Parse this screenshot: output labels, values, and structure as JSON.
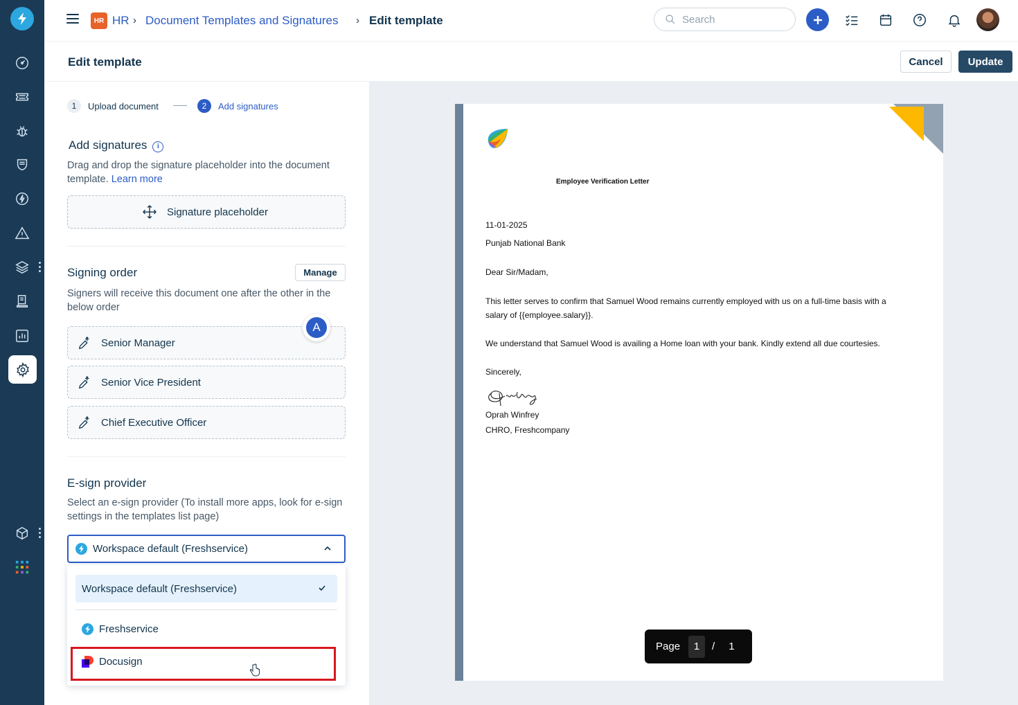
{
  "breadcrumb": {
    "module_badge": "HR",
    "module": "HR",
    "section": "Document Templates and Signatures",
    "current": "Edit template"
  },
  "search": {
    "placeholder": "Search"
  },
  "header": {
    "title": "Edit template",
    "cancel_label": "Cancel",
    "update_label": "Update"
  },
  "steps": [
    {
      "number": "1",
      "label": "Upload document"
    },
    {
      "number": "2",
      "label": "Add signatures"
    }
  ],
  "add_signatures": {
    "title": "Add signatures",
    "description": "Drag and drop the signature placeholder into the document template.",
    "learn_more": "Learn more",
    "placeholder_label": "Signature placeholder"
  },
  "signing_order": {
    "title": "Signing order",
    "manage_label": "Manage",
    "description": "Signers will receive this document one after the other in the below order",
    "signers": [
      "Senior Manager",
      "Senior Vice President",
      "Chief Executive Officer"
    ],
    "marker_letter": "A"
  },
  "esign": {
    "title": "E-sign provider",
    "description": "Select an e-sign provider (To install more apps, look for e-sign settings in the templates list page)",
    "selected": "Workspace default (Freshservice)",
    "options": [
      "Workspace default (Freshservice)",
      "Freshservice",
      "Docusign"
    ]
  },
  "document": {
    "title": "Employee Verification Letter",
    "date": "11-01-2025",
    "recipient": "Punjab National Bank",
    "salutation": "Dear Sir/Madam,",
    "para1_line1": "This letter serves to confirm that Samuel Wood remains currently employed with us on a full-time basis with a",
    "para1_line2": "salary of {{employee.salary}}.",
    "para2": "We understand that Samuel Wood is availing a Home loan with your bank. Kindly extend all due courtesies.",
    "closing": "Sincerely,",
    "signer_name": "Oprah Winfrey",
    "signer_title": "CHRO, Freshcompany"
  },
  "pager": {
    "label": "Page",
    "current": "1",
    "separator": "/",
    "total": "1"
  },
  "colors": {
    "accent": "#2c5cc5",
    "rail": "#1b3a55",
    "highlight": "#d7171f"
  }
}
